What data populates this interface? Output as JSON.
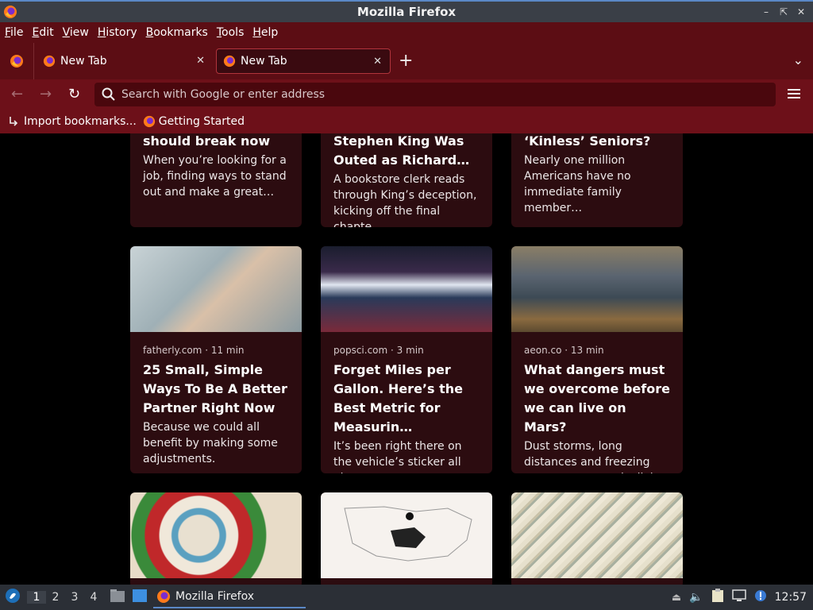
{
  "window": {
    "title": "Mozilla Firefox"
  },
  "menubar": [
    {
      "key": "F",
      "rest": "ile"
    },
    {
      "key": "E",
      "rest": "dit"
    },
    {
      "key": "V",
      "rest": "iew"
    },
    {
      "key": "H",
      "rest": "istory"
    },
    {
      "key": "B",
      "rest": "ookmarks"
    },
    {
      "key": "T",
      "rest": "ools"
    },
    {
      "key": "H",
      "rest": "elp"
    }
  ],
  "tabs": [
    {
      "label": "New Tab"
    },
    {
      "label": "New Tab"
    }
  ],
  "urlbar": {
    "placeholder": "Search with Google or enter address"
  },
  "bookmarks": {
    "import_label": "Import bookmarks...",
    "getting_started_label": "Getting Started"
  },
  "cards_top": [
    {
      "headline": "should break now",
      "excerpt": "When you’re looking for a job, finding ways to stand out and make a great…"
    },
    {
      "headline": "Stephen King Was Outed as Richard…",
      "excerpt": "A bookstore clerk reads through King’s deception, kicking off the final chapte…"
    },
    {
      "headline": "‘Kinless’ Seniors?",
      "excerpt": "Nearly one million Americans have no immediate family member…"
    }
  ],
  "cards": [
    {
      "source": "fatherly.com · 11 min",
      "headline": "25 Small, Simple Ways To Be A Better Partner Right Now",
      "excerpt": "Because we could all benefit by making some adjustments."
    },
    {
      "source": "popsci.com · 3 min",
      "headline": "Forget Miles per Gallon. Here’s the Best Metric for Measurin…",
      "excerpt": "It’s been right there on the vehicle’s sticker all along."
    },
    {
      "source": "aeon.co · 13 min",
      "headline": "What dangers must we overcome before we can live on Mars?",
      "excerpt": "Dust storms, long distances and freezing temperatures make living on Mars…"
    }
  ],
  "taskbar": {
    "workspaces": [
      "1",
      "2",
      "3",
      "4"
    ],
    "task_label": "Mozilla Firefox",
    "clock": "12:57"
  },
  "colors": {
    "accent": "#5a88c6",
    "menubar_bg": "#5c0d14",
    "toolbar_bg": "#6d1019",
    "card_bg": "#2c0c10"
  }
}
